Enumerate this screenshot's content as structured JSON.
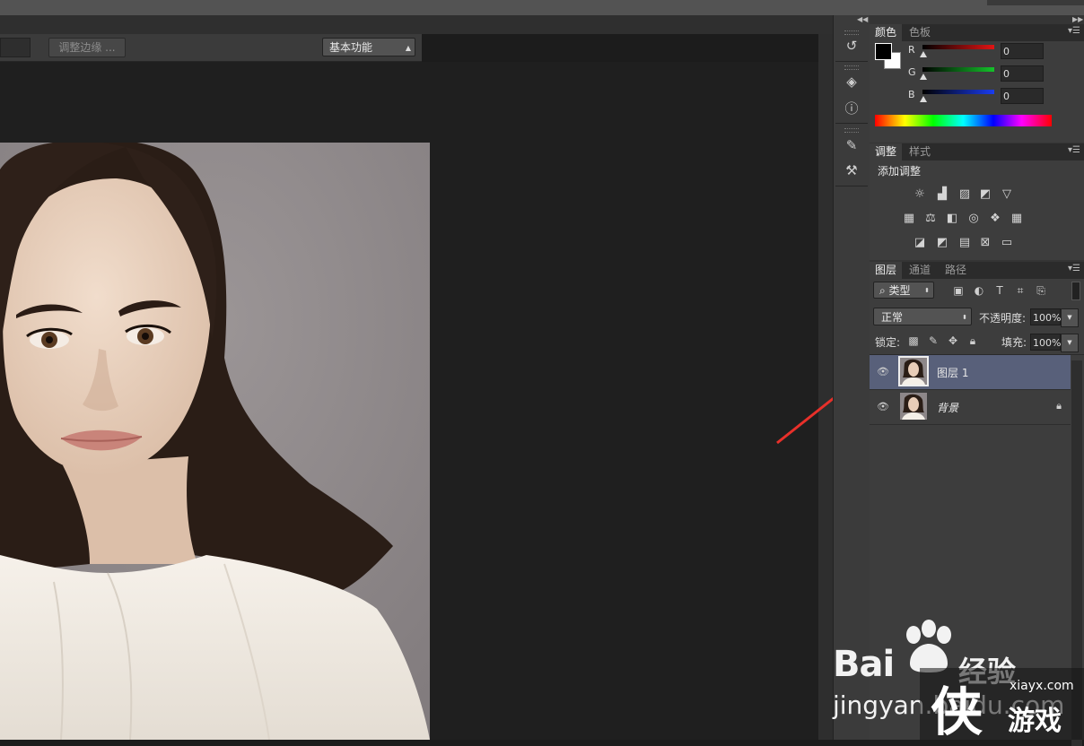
{
  "options_bar": {
    "refine_edge_label": "调整边缘 ...",
    "workspace_label": "基本功能"
  },
  "color_panel": {
    "tabs": [
      "颜色",
      "色板"
    ],
    "channels": [
      {
        "label": "R",
        "value": "0",
        "color": "#d01010"
      },
      {
        "label": "G",
        "value": "0",
        "color": "#10b020"
      },
      {
        "label": "B",
        "value": "0",
        "color": "#1030e0"
      }
    ],
    "foreground": "#000000",
    "background": "#ffffff"
  },
  "adjustments_panel": {
    "tabs": [
      "调整",
      "样式"
    ],
    "title": "添加调整",
    "icons_row1": [
      "brightness-contrast-icon",
      "levels-icon",
      "curves-icon",
      "exposure-icon",
      "vibrance-icon"
    ],
    "icons_row2": [
      "hue-saturation-icon",
      "color-balance-icon",
      "black-white-icon",
      "photo-filter-icon",
      "channel-mixer-icon",
      "color-lookup-icon"
    ],
    "icons_row3": [
      "invert-icon",
      "posterize-icon",
      "threshold-icon",
      "selective-color-icon",
      "gradient-map-icon"
    ]
  },
  "layers_panel": {
    "tabs": [
      "图层",
      "通道",
      "路径"
    ],
    "filter_label": "类型",
    "blend_mode": "正常",
    "opacity_label": "不透明度:",
    "opacity_value": "100%",
    "lock_label": "锁定:",
    "fill_label": "填充:",
    "fill_value": "100%",
    "layers": [
      {
        "name": "图层 1",
        "selected": true,
        "locked": false
      },
      {
        "name": "背景",
        "selected": false,
        "locked": true
      }
    ]
  },
  "watermark": {
    "brand": "Bai",
    "brand_cn": "经验",
    "url": "jingyan.baidu.com",
    "site": "xiayx.com",
    "site_cn": "游戏"
  }
}
